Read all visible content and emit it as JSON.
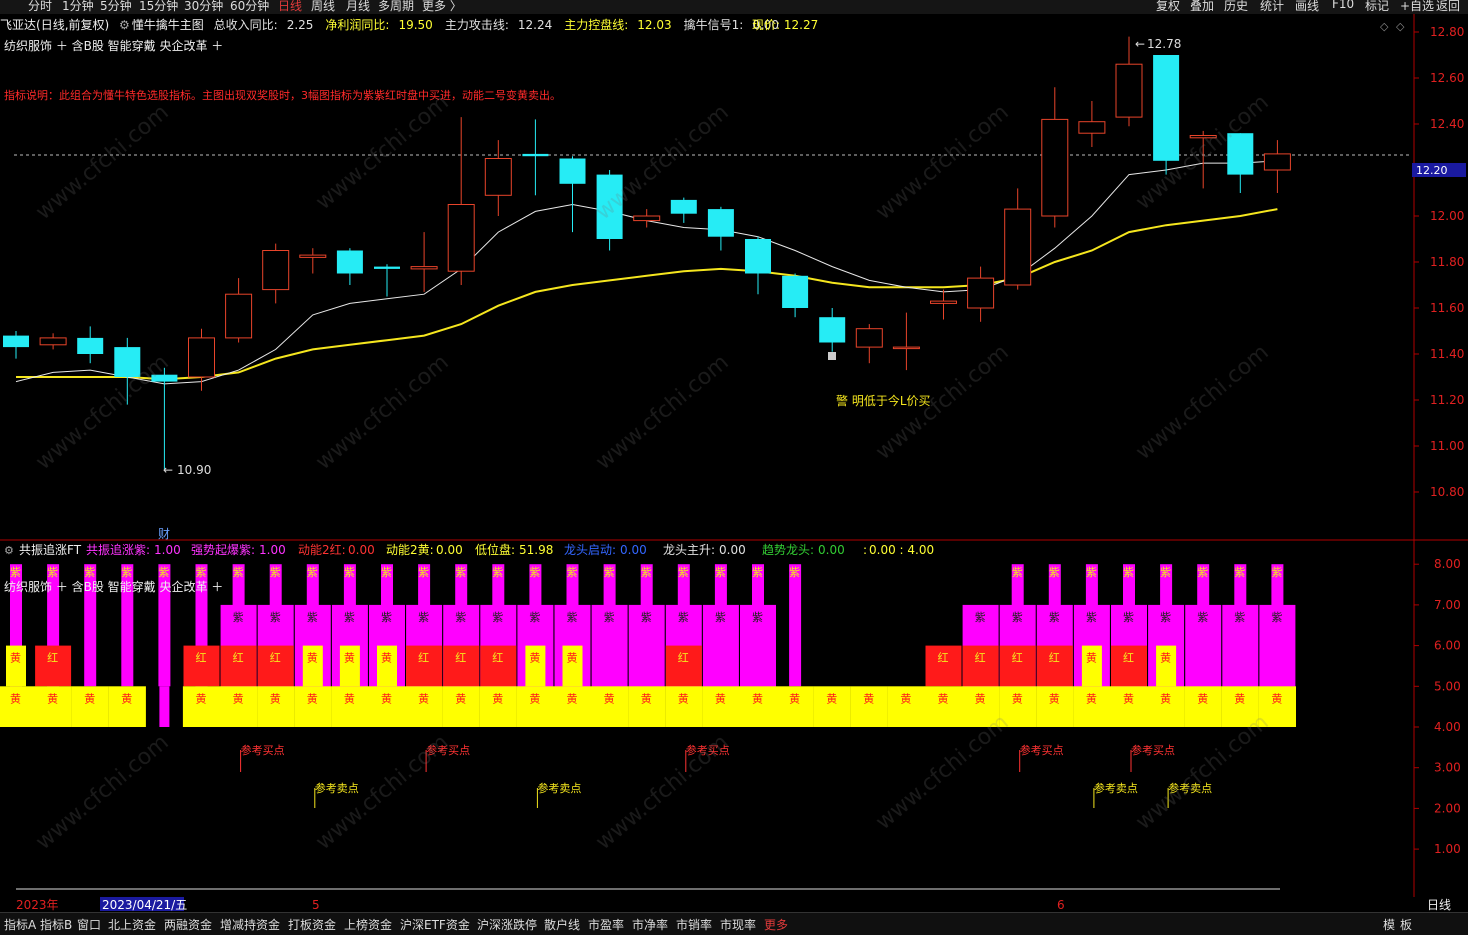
{
  "topbar": {
    "periods": [
      "分时",
      "1分钟",
      "5分钟",
      "15分钟",
      "30分钟",
      "60分钟",
      "日线",
      "周线",
      "月线",
      "多周期",
      "更多 〉"
    ],
    "active_period": "日线",
    "tools": [
      "复权",
      "叠加",
      "历史",
      "统计",
      "画线",
      "F10",
      "标记",
      "+自选",
      "返回"
    ]
  },
  "stock": {
    "name": "飞亚达",
    "mode": "(日线,前复权)",
    "indicator": "懂牛擒牛主图",
    "items": [
      {
        "label": "总收入同比:",
        "value": "2.25",
        "color": "#e0e0e0"
      },
      {
        "label": "净利润同比:",
        "value": "19.50",
        "color": "#ffff33"
      },
      {
        "label": "主力攻击线:",
        "value": "12.24",
        "color": "#e0e0e0"
      },
      {
        "label": "主力控盘线:",
        "value": "12.03",
        "color": "#ffff33"
      },
      {
        "label": "擒牛信号1:",
        "value": "0.00",
        "color": "#e0e0e0"
      }
    ],
    "current_label": "现价:",
    "current_value": "12.27"
  },
  "tags_main": "纺织服饰 ＋ 含B股 智能穿戴 央企改革 ＋",
  "explanation": "指标说明：此组合为懂牛特色选股指标。主图出现双奖股时，3幅图指标为紫紫红时盘中买进，动能二号变黄卖出。",
  "annotations": {
    "high": "12.78",
    "low": "10.90",
    "signal": "警 明低于今L价买",
    "cai": "财",
    "current_tag": "12.20"
  },
  "price_axis": [
    "12.80",
    "12.60",
    "12.40",
    "12.20",
    "12.00",
    "11.80",
    "11.60",
    "11.40",
    "11.20",
    "11.00",
    "10.80"
  ],
  "sub": {
    "name": "共振追涨FT",
    "items": [
      {
        "label": "共振追涨紫:",
        "value": "1.00",
        "color": "#ff33ff"
      },
      {
        "label": "强势起爆紫:",
        "value": "1.00",
        "color": "#ff33ff"
      },
      {
        "label": "动能2红:",
        "value": "0.00",
        "color": "#ff3333"
      },
      {
        "label": "动能2黄:",
        "value": "0.00",
        "color": "#ffff33"
      },
      {
        "label": "低位盘:",
        "value": "51.98",
        "color": "#ffff33"
      },
      {
        "label": "龙头启动:",
        "value": "0.00",
        "color": "#3366ff"
      },
      {
        "label": "龙头主升:",
        "value": "0.00",
        "color": "#e0e0e0"
      },
      {
        "label": "趋势龙头:",
        "value": "0.00",
        "color": "#33cc33"
      },
      {
        "label": ":",
        "value": "0.00 : 4.00",
        "color": "#ffff33"
      }
    ],
    "axis": [
      "8.00",
      "7.00",
      "6.00",
      "5.00",
      "4.00",
      "3.00",
      "2.00",
      "1.00"
    ],
    "buy_label": "参考买点",
    "sell_label": "参考卖点",
    "ch_zi": "紫",
    "ch_hong": "红",
    "ch_huang": "黄"
  },
  "date_axis": {
    "year": "2023年",
    "cursor_date": "2023/04/21/五",
    "m5": "5",
    "m6": "6",
    "period": "日线"
  },
  "bottombar": {
    "items": [
      "指标A",
      "指标B",
      "窗口",
      "北上资金",
      "两融资金",
      "增减持资金",
      "打板资金",
      "上榜资金",
      "沪深ETF资金",
      "沪深涨跌停",
      "散户线",
      "市盈率",
      "市净率",
      "市销率",
      "市现率",
      "更多"
    ],
    "active": "更多",
    "right": [
      "模",
      "板"
    ]
  },
  "watermark": "www.cfchi.com",
  "chart_data": {
    "type": "candlestick",
    "candles": [
      [
        11.48,
        11.43,
        11.5,
        11.38
      ],
      [
        11.44,
        11.47,
        11.49,
        11.42
      ],
      [
        11.47,
        11.4,
        11.52,
        11.36
      ],
      [
        11.43,
        11.3,
        11.47,
        11.18
      ],
      [
        11.31,
        11.28,
        11.34,
        10.9
      ],
      [
        11.3,
        11.47,
        11.51,
        11.24
      ],
      [
        11.47,
        11.66,
        11.73,
        11.45
      ],
      [
        11.68,
        11.85,
        11.88,
        11.62
      ],
      [
        11.82,
        11.83,
        11.86,
        11.75
      ],
      [
        11.85,
        11.75,
        11.86,
        11.7
      ],
      [
        11.78,
        11.77,
        11.79,
        11.65
      ],
      [
        11.77,
        11.78,
        11.93,
        11.67
      ],
      [
        11.76,
        12.05,
        12.43,
        11.7
      ],
      [
        12.09,
        12.25,
        12.33,
        12.0
      ],
      [
        12.27,
        12.26,
        12.42,
        12.09
      ],
      [
        12.25,
        12.14,
        12.26,
        11.93
      ],
      [
        12.18,
        11.9,
        12.2,
        11.85
      ],
      [
        11.98,
        12.0,
        12.03,
        11.95
      ],
      [
        12.07,
        12.01,
        12.08,
        11.97
      ],
      [
        12.03,
        11.91,
        12.04,
        11.85
      ],
      [
        11.9,
        11.75,
        11.91,
        11.66
      ],
      [
        11.74,
        11.6,
        11.75,
        11.56
      ],
      [
        11.56,
        11.45,
        11.6,
        11.41
      ],
      [
        11.43,
        11.51,
        11.53,
        11.36
      ],
      [
        11.43,
        11.43,
        11.58,
        11.33
      ],
      [
        11.62,
        11.63,
        11.68,
        11.55
      ],
      [
        11.6,
        11.73,
        11.78,
        11.54
      ],
      [
        11.7,
        12.03,
        12.12,
        11.68
      ],
      [
        12.0,
        12.42,
        12.56,
        11.95
      ],
      [
        12.36,
        12.41,
        12.5,
        12.3
      ],
      [
        12.43,
        12.66,
        12.78,
        12.39
      ],
      [
        12.7,
        12.24,
        12.7,
        12.18
      ],
      [
        12.34,
        12.35,
        12.37,
        12.12
      ],
      [
        12.36,
        12.18,
        12.36,
        12.1
      ],
      [
        12.2,
        12.27,
        12.33,
        12.1
      ]
    ],
    "ma_white": [
      11.28,
      11.32,
      11.33,
      11.3,
      11.27,
      11.28,
      11.33,
      11.42,
      11.57,
      11.62,
      11.64,
      11.66,
      11.77,
      11.93,
      12.02,
      12.05,
      12.02,
      11.98,
      11.95,
      11.94,
      11.91,
      11.85,
      11.78,
      11.72,
      11.69,
      11.67,
      11.68,
      11.74,
      11.86,
      12.0,
      12.18,
      12.2,
      12.23,
      12.23,
      12.24
    ],
    "ma_yellow": [
      11.3,
      11.3,
      11.3,
      11.3,
      11.29,
      11.3,
      11.32,
      11.38,
      11.42,
      11.44,
      11.46,
      11.48,
      11.53,
      11.61,
      11.67,
      11.7,
      11.72,
      11.74,
      11.76,
      11.77,
      11.76,
      11.74,
      11.71,
      11.69,
      11.69,
      11.69,
      11.7,
      11.73,
      11.8,
      11.85,
      11.93,
      11.96,
      11.98,
      12.0,
      12.03
    ]
  }
}
